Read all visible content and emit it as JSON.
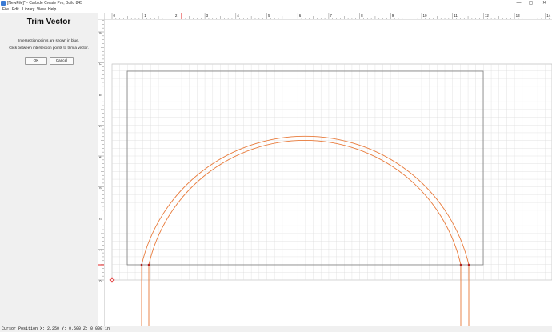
{
  "window": {
    "title": "[NewFile]* - Carbide Create Pro, Build 845",
    "minimize_glyph": "—",
    "maximize_glyph": "▢",
    "close_glyph": "✕"
  },
  "menu": [
    "File",
    "Edit",
    "Library",
    "View",
    "Help"
  ],
  "panel": {
    "title": "Trim Vector",
    "instruction_1": "Intersection points are shown in blue.",
    "instruction_2": "Click between intersection points to trim a vector.",
    "ok_label": "OK",
    "cancel_label": "Cancel"
  },
  "ruler": {
    "top_ticks": [
      "0",
      "1",
      "2",
      "3",
      "4",
      "5",
      "6",
      "7",
      "8",
      "9",
      "10",
      "11",
      "12",
      "13",
      "14"
    ],
    "left_ticks": [
      "8",
      "7",
      "6",
      "5",
      "4",
      "3",
      "2",
      "1",
      "0"
    ]
  },
  "colors": {
    "vector": "#e87a3a",
    "stock": "#7d7d7d",
    "grid": "#dcdcdc",
    "ruler_marker": "#e02020"
  },
  "status": {
    "cursor_position": "Cursor Position X: 2.250 Y: 0.500 Z: 0.000 in"
  }
}
